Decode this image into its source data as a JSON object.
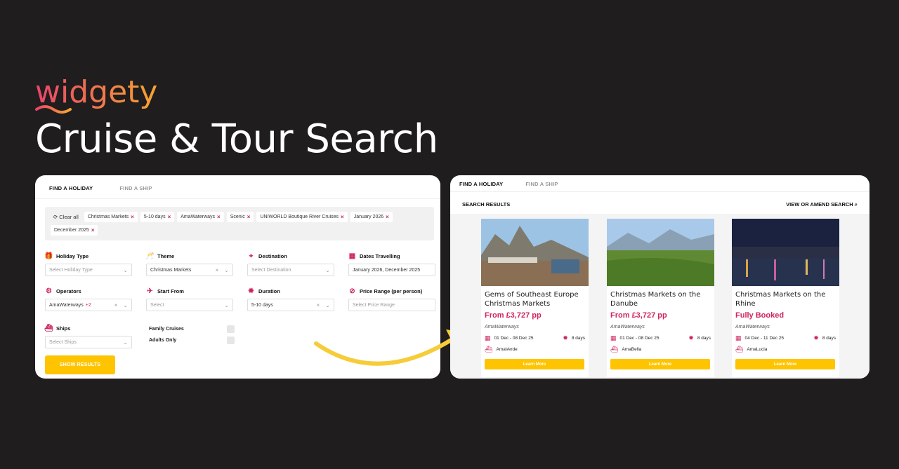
{
  "brand": {
    "logo_text": "widgety",
    "headline": "Cruise & Tour Search"
  },
  "search_panel": {
    "tabs": [
      "FIND A HOLIDAY",
      "FIND A SHIP"
    ],
    "clear_all": "Clear all",
    "chips": [
      "Christmas Markets",
      "5-10 days",
      "AmaWaterways",
      "Scenic",
      "UNIWORLD Boutique River Cruises",
      "January 2026",
      "December 2025"
    ],
    "fields": {
      "holiday_type": {
        "label": "Holiday Type",
        "placeholder": "Select Holiday Type"
      },
      "theme": {
        "label": "Theme",
        "value": "Christmas Markets"
      },
      "destination": {
        "label": "Destination",
        "placeholder": "Select Destination"
      },
      "dates": {
        "label": "Dates Travelling",
        "value": "January 2026, December 2025"
      },
      "operators": {
        "label": "Operators",
        "value": "AmaWaterways",
        "extra": "+2"
      },
      "start_from": {
        "label": "Start From",
        "placeholder": "Select"
      },
      "duration": {
        "label": "Duration",
        "value": "5-10 days"
      },
      "price_range": {
        "label": "Price Range (per person)",
        "placeholder": "Select Price Range"
      },
      "ships": {
        "label": "Ships",
        "placeholder": "Select Ships"
      }
    },
    "toggles": [
      "Family Cruises",
      "Adults Only"
    ],
    "show_results": "SHOW RESULTS"
  },
  "results_panel": {
    "tabs": [
      "FIND A HOLIDAY",
      "FIND A SHIP"
    ],
    "heading": "SEARCH RESULTS",
    "amend": "VIEW OR AMEND SEARCH",
    "cards": [
      {
        "title": "Gems of Southeast Europe Christmas Markets",
        "price": "From £3,727 pp",
        "operator": "AmaWaterways",
        "dates": "01 Dec - 08 Dec 25",
        "duration": "8 days",
        "ship": "AmaVerde",
        "button": "Learn More"
      },
      {
        "title": "Christmas Markets on the Danube",
        "price": "From £3,727 pp",
        "operator": "AmaWaterways",
        "dates": "01 Dec - 08 Dec 25",
        "duration": "8 days",
        "ship": "AmaBella",
        "button": "Learn More"
      },
      {
        "title": "Christmas Markets on the Rhine",
        "price": "Fully Booked",
        "operator": "AmaWaterways",
        "dates": "04 Dec - 11 Dec 25",
        "duration": "8 days",
        "ship": "AmaLucia",
        "button": "Learn More"
      }
    ]
  },
  "colors": {
    "background": "#1f1d1d",
    "accent": "#d0245e",
    "button": "#ffc400",
    "logo_gradient_start": "#e8456b",
    "logo_gradient_end": "#f7a531"
  },
  "icons": [
    "refresh-icon",
    "close-icon",
    "chevron-down-icon",
    "gift-icon",
    "drinks-icon",
    "map-pin-icon",
    "calendar-icon",
    "settings-icon",
    "plane-icon",
    "sun-icon",
    "price-tag-icon",
    "ship-icon",
    "search-icon",
    "arrow-icon"
  ]
}
